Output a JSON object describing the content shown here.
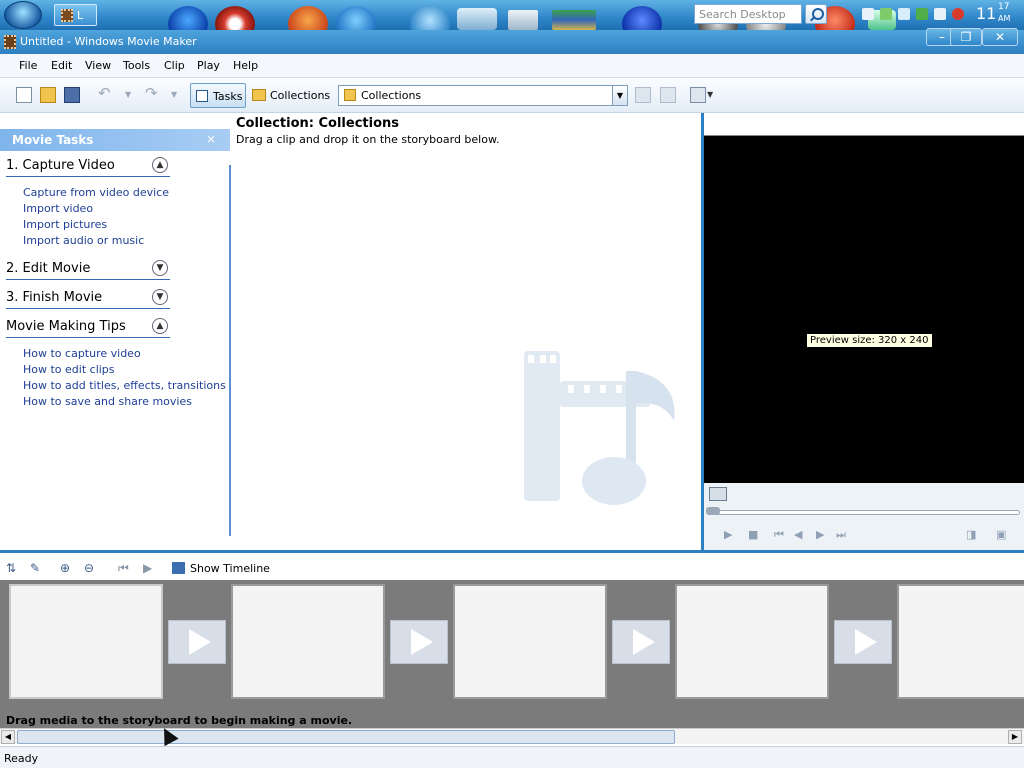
{
  "taskbar": {
    "search_placeholder": "Search Desktop",
    "task_button_label": "L",
    "clock_hour": "11",
    "clock_minute": "17",
    "clock_ampm": "AM"
  },
  "window": {
    "title": "Untitled - Windows Movie Maker",
    "minimize_label": "–",
    "restore_label": "❐",
    "close_label": "✕"
  },
  "menu": {
    "items": [
      "File",
      "Edit",
      "View",
      "Tools",
      "Clip",
      "Play",
      "Help"
    ]
  },
  "toolbar": {
    "tasks_label": "Tasks",
    "collections_label": "Collections",
    "collection_selected": "Collections"
  },
  "task_pane": {
    "header": "Movie Tasks",
    "close_label": "×",
    "sections": [
      {
        "title": "1. Capture Video",
        "expanded": true,
        "links": [
          "Capture from video device",
          "Import video",
          "Import pictures",
          "Import audio or music"
        ]
      },
      {
        "title": "2. Edit Movie",
        "expanded": false,
        "links": []
      },
      {
        "title": "3. Finish Movie",
        "expanded": false,
        "links": []
      },
      {
        "title": "Movie Making Tips",
        "expanded": true,
        "links": [
          "How to capture video",
          "How to edit clips",
          "How to add titles, effects, transitions",
          "How to save and share movies"
        ]
      }
    ]
  },
  "collection": {
    "title": "Collection: Collections",
    "subtitle": "Drag a clip and drop it on the storyboard below."
  },
  "monitor": {
    "tooltip": "Preview size: 320 x 240"
  },
  "storyboard": {
    "show_timeline_label": "Show Timeline",
    "hint": "Drag media to the storyboard to begin making a movie.",
    "frame_count": 5
  },
  "status": {
    "text": "Ready"
  },
  "colors": {
    "accent": "#2c7fc1",
    "task_header": "#7fb5ec",
    "storyboard_bg": "#7b7b7b",
    "link": "#1f3f95"
  }
}
